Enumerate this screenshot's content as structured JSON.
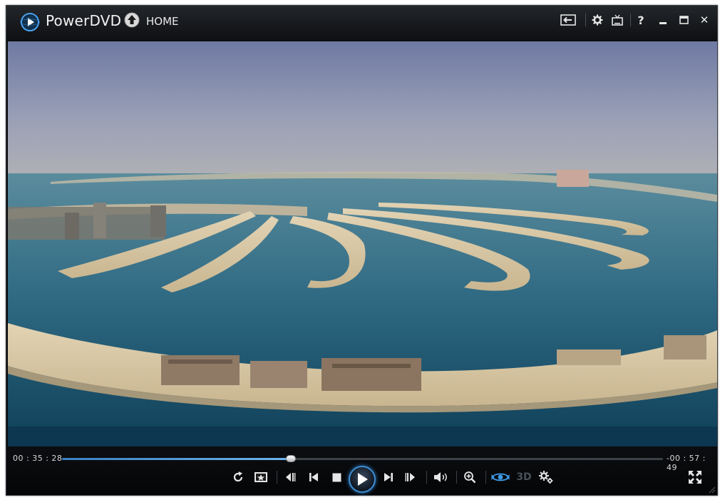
{
  "window": {
    "app_title": "PowerDVD",
    "home_label": "HOME"
  },
  "title_icons": [
    "back-to-desktop-icon",
    "settings-gear-icon",
    "tv-mode-icon",
    "help-icon",
    "minimize-icon",
    "maximize-icon",
    "close-icon"
  ],
  "title_text": {
    "help": "?",
    "close": "✕"
  },
  "playback": {
    "elapsed": "00 : 35 : 28",
    "remaining": "-00 : 57 : 49",
    "progress": 0.381
  },
  "controls": {
    "three_d_label": "3D",
    "icons": [
      "repeat-icon",
      "snapshot-icon",
      "step-back-icon",
      "previous-icon",
      "stop-icon",
      "play-icon",
      "next-icon",
      "step-forward-icon",
      "volume-icon",
      "zoom-icon",
      "trueview-eye-icon",
      "3d-icon",
      "more-settings-icon",
      "fullscreen-icon"
    ]
  },
  "colors": {
    "accent": "#3d8fd6",
    "background": "#0b0c0e"
  }
}
